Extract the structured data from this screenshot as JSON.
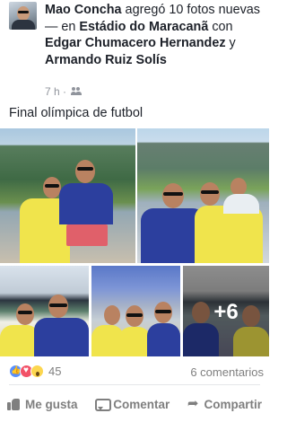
{
  "post": {
    "author": "Mao Concha",
    "action_text": " agregó 10 fotos nuevas — en ",
    "location": "Estádio do Maracanã",
    "with_text": " con ",
    "tagged_1": "Edgar Chumacero Hernandez",
    "and_text": " y ",
    "tagged_2": "Armando Ruiz Solís",
    "time": "7 h ·",
    "privacy_icon": "friends-icon",
    "caption": "Final olímpica de futbol"
  },
  "photos": {
    "more_label": "+6"
  },
  "footer": {
    "reaction_count": "45",
    "comments_label": "6 comentarios",
    "reaction_icons": [
      "like-icon",
      "love-icon",
      "wow-icon"
    ]
  },
  "actions": {
    "like_label": "Me gusta",
    "comment_label": "Comentar",
    "share_label": "Compartir"
  },
  "colors": {
    "link_blue": "#365899",
    "meta_gray": "#90949c",
    "action_gray": "#7f7f7f",
    "jersey_yellow": "#f0e44c",
    "jersey_blue": "#2c3f9e"
  }
}
